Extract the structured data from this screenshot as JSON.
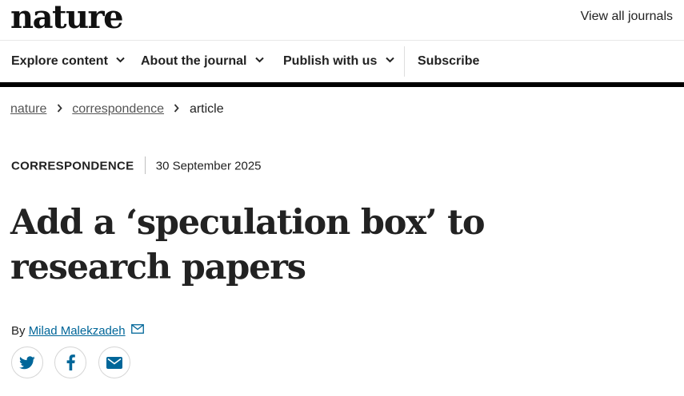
{
  "header": {
    "logo_text": "nature",
    "view_all_label": "View all journals"
  },
  "nav": {
    "items": [
      {
        "label": "Explore content",
        "icon": "chevron-down-icon"
      },
      {
        "label": "About the journal",
        "icon": "chevron-down-icon"
      },
      {
        "label": "Publish with us",
        "icon": "chevron-down-icon"
      }
    ],
    "subscribe_label": "Subscribe"
  },
  "breadcrumb": {
    "items": [
      "nature",
      "correspondence",
      "article"
    ],
    "separator_icon": "chevron-right-icon"
  },
  "article": {
    "type": "CORRESPONDENCE",
    "date": "30 September 2025",
    "title": "Add a ‘speculation box’ to research papers",
    "by_prefix": "By",
    "author": "Milad Malekzadeh",
    "author_icon": "envelope-icon"
  },
  "share": {
    "icons": [
      "twitter-icon",
      "facebook-icon",
      "email-icon"
    ],
    "icon_color": "#006699"
  },
  "colors": {
    "text": "#222222",
    "link": "#006699",
    "divider_bar": "#000000"
  }
}
